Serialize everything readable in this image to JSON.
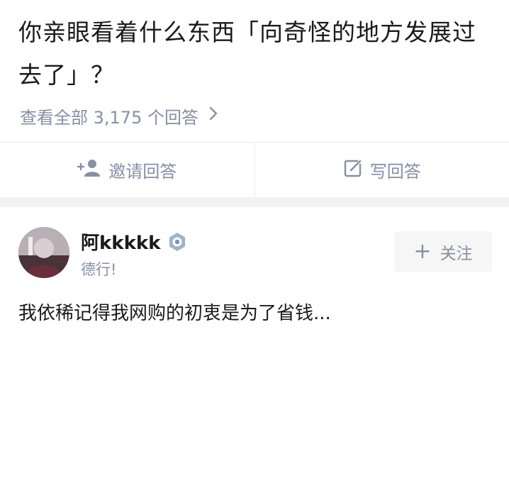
{
  "question": {
    "title": "你亲眼看着什么东西「向奇怪的地方发展过去了」？",
    "view_all": "查看全部 3,175 个回答"
  },
  "actions": {
    "invite_label": "邀请回答",
    "write_label": "写回答"
  },
  "answer": {
    "author_name": "阿kkkkk",
    "author_bio": "德行!",
    "follow_label": "关注",
    "excerpt": "我依稀记得我网购的初衷是为了省钱..."
  },
  "icons": {
    "view_all": "chevron-right-icon",
    "invite": "add-user-icon",
    "write": "edit-icon",
    "badge": "verified-badge-icon",
    "follow": "plus-icon"
  },
  "colors": {
    "secondary_text": "#8590a6",
    "primary_text": "#1a1a1a",
    "divider": "#ececec",
    "section_gap": "#f2f2f2"
  }
}
